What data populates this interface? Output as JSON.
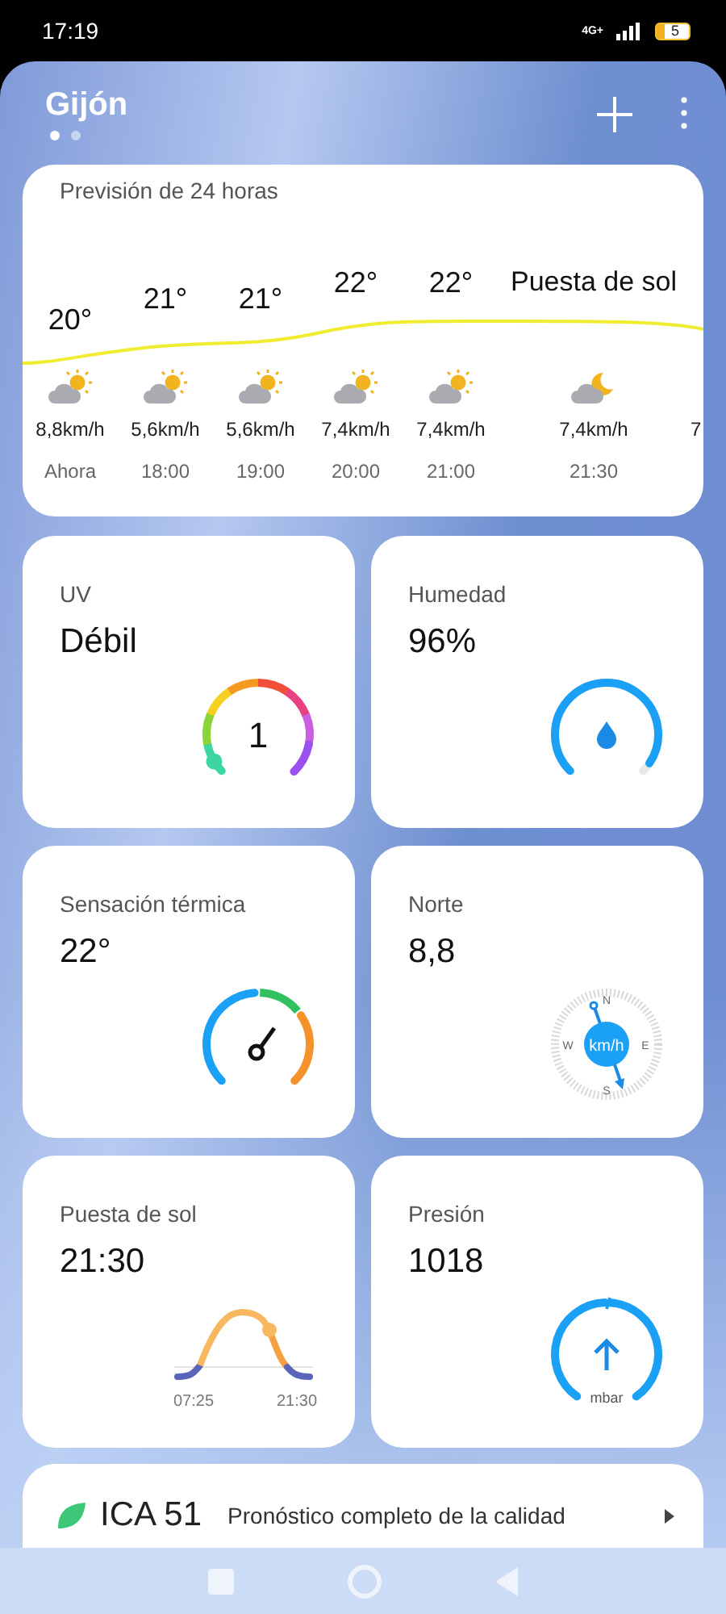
{
  "status_bar": {
    "time": "17:19",
    "network": "4G+",
    "battery": "5"
  },
  "header": {
    "city": "Gijón",
    "pages": [
      {
        "selected": true
      },
      {
        "selected": false
      }
    ]
  },
  "forecast": {
    "title": "Previsión de 24 horas",
    "hours": [
      {
        "kind": "hour",
        "temp": "20°",
        "wind": "8,8km/h",
        "time": "Ahora"
      },
      {
        "kind": "hour",
        "temp": "21°",
        "wind": "5,6km/h",
        "time": "18:00"
      },
      {
        "kind": "hour",
        "temp": "21°",
        "wind": "5,6km/h",
        "time": "19:00"
      },
      {
        "kind": "hour",
        "temp": "22°",
        "wind": "7,4km/h",
        "time": "20:00"
      },
      {
        "kind": "hour",
        "temp": "22°",
        "wind": "7,4km/h",
        "time": "21:00"
      },
      {
        "kind": "sunset",
        "temp": "Puesta de sol",
        "wind": "7,4km/h",
        "time": "21:30"
      },
      {
        "kind": "partial",
        "wind": "7"
      }
    ]
  },
  "tiles": [
    {
      "kind": "uv",
      "label": "UV",
      "value": "Débil",
      "reading": "1",
      "level": 0.05
    },
    {
      "kind": "humidity",
      "label": "Humedad",
      "value": "96%"
    },
    {
      "kind": "feels",
      "label": "Sensación térmica",
      "value": "22°"
    },
    {
      "kind": "wind",
      "label": "Norte",
      "value": "8,8",
      "unit": "km/h",
      "directions": [
        "N",
        "W",
        "E",
        "S"
      ]
    },
    {
      "kind": "sunset",
      "label": "Puesta de sol",
      "value": "21:30",
      "sunrise_time": "07:25",
      "sunset_time": "21:30"
    },
    {
      "kind": "pressure",
      "label": "Presión",
      "value": "1018",
      "unit": "mbar"
    }
  ],
  "air_quality": {
    "index": "ICA 51",
    "text": "Pronóstico completo de la calidad"
  }
}
